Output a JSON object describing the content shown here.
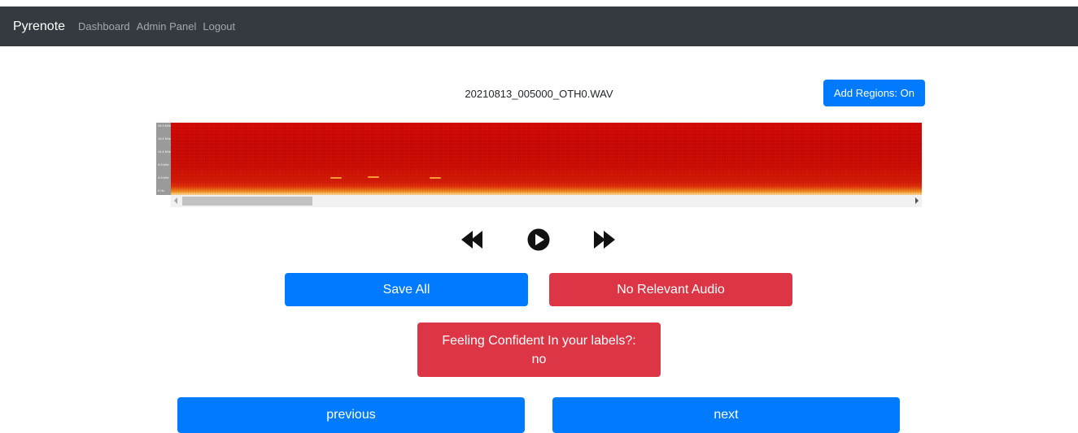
{
  "navbar": {
    "brand": "Pyrenote",
    "links": [
      "Dashboard",
      "Admin Panel",
      "Logout"
    ]
  },
  "file": {
    "name": "20210813_005000_OTH0.WAV"
  },
  "toolbar": {
    "add_regions_label": "Add Regions: On"
  },
  "spectrogram": {
    "y_tick_labels": [
      "24.0 kHz",
      "19.2 kHz",
      "14.4 kHz",
      "9.6 kHz",
      "4.8 kHz",
      "0 Hz"
    ]
  },
  "transport": {
    "icons": [
      "rewind-icon",
      "play-icon",
      "fast-forward-icon"
    ]
  },
  "actions": {
    "save_all_label": "Save All",
    "no_relevant_label": "No Relevant Audio",
    "confident_label": "Feeling Confident In your labels?:",
    "confident_value": "no"
  },
  "pagination": {
    "previous_label": "previous",
    "next_label": "next"
  },
  "colors": {
    "navbar": "#343a40",
    "primary": "#007bff",
    "danger": "#dc3545"
  }
}
